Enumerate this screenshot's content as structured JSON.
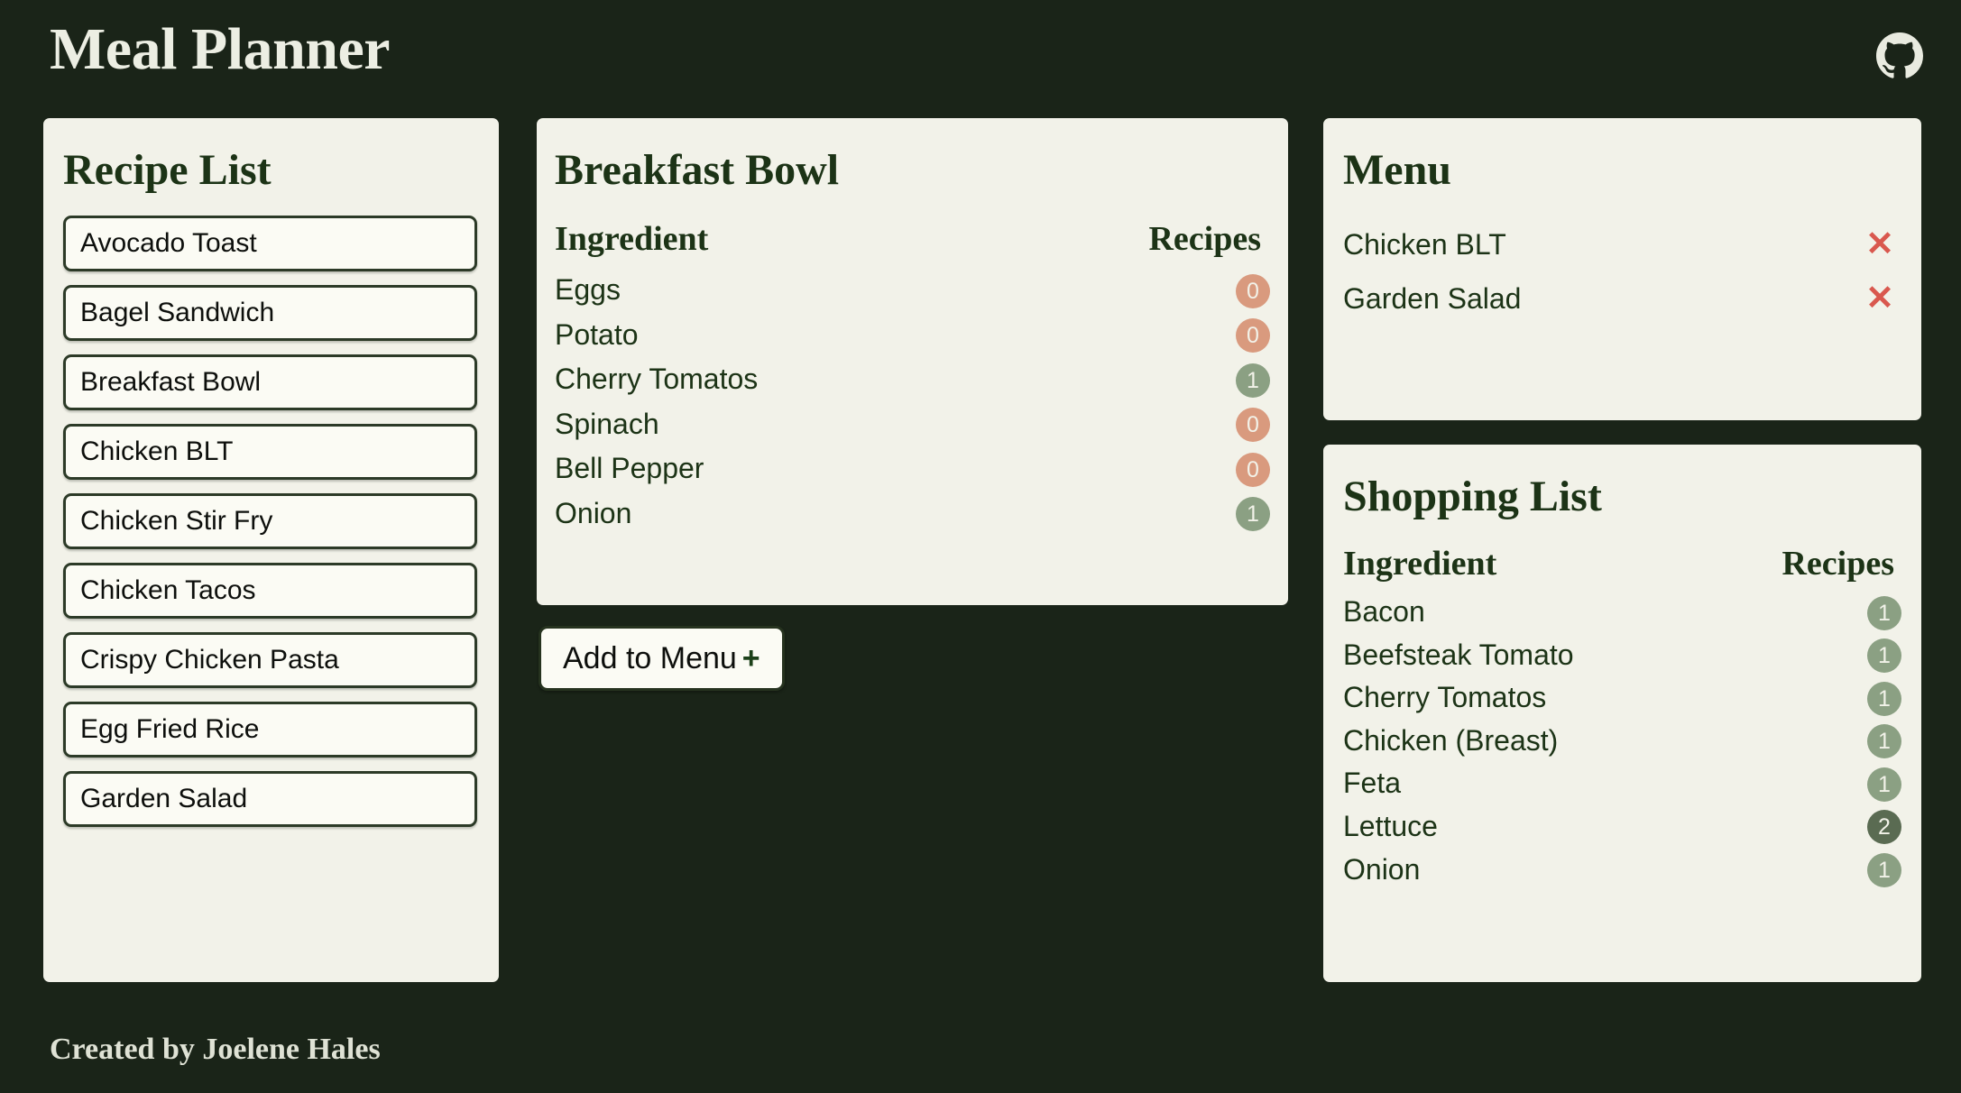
{
  "app": {
    "title": "Meal Planner",
    "background_color": "#1a2418",
    "panel_color": "#f2f2e9",
    "accent_green": "#1c3316"
  },
  "header": {
    "github_icon": "github-icon"
  },
  "recipe_list": {
    "title": "Recipe List",
    "items": [
      {
        "label": "Avocado Toast"
      },
      {
        "label": "Bagel Sandwich"
      },
      {
        "label": "Breakfast Bowl"
      },
      {
        "label": "Chicken BLT"
      },
      {
        "label": "Chicken Stir Fry"
      },
      {
        "label": "Chicken Tacos"
      },
      {
        "label": "Crispy Chicken Pasta"
      },
      {
        "label": "Egg Fried Rice"
      },
      {
        "label": "Garden Salad"
      }
    ]
  },
  "recipe_detail": {
    "title": "Breakfast Bowl",
    "columns": {
      "ingredient": "Ingredient",
      "recipes": "Recipes"
    },
    "rows": [
      {
        "ingredient": "Eggs",
        "count": "0",
        "badge": "zero"
      },
      {
        "ingredient": "Potato",
        "count": "0",
        "badge": "zero"
      },
      {
        "ingredient": "Cherry Tomatos",
        "count": "1",
        "badge": "one"
      },
      {
        "ingredient": "Spinach",
        "count": "0",
        "badge": "zero"
      },
      {
        "ingredient": "Bell Pepper",
        "count": "0",
        "badge": "zero"
      },
      {
        "ingredient": "Onion",
        "count": "1",
        "badge": "one"
      }
    ],
    "add_button": {
      "label": "Add to Menu",
      "plus": "+"
    }
  },
  "menu": {
    "title": "Menu",
    "items": [
      {
        "label": "Chicken BLT",
        "remove_icon": "✕"
      },
      {
        "label": "Garden Salad",
        "remove_icon": "✕"
      }
    ]
  },
  "shopping_list": {
    "title": "Shopping List",
    "columns": {
      "ingredient": "Ingredient",
      "recipes": "Recipes"
    },
    "rows": [
      {
        "ingredient": "Bacon",
        "count": "1",
        "badge": "one"
      },
      {
        "ingredient": "Beefsteak Tomato",
        "count": "1",
        "badge": "one"
      },
      {
        "ingredient": "Cherry Tomatos",
        "count": "1",
        "badge": "one"
      },
      {
        "ingredient": "Chicken (Breast)",
        "count": "1",
        "badge": "one"
      },
      {
        "ingredient": "Feta",
        "count": "1",
        "badge": "one"
      },
      {
        "ingredient": "Lettuce",
        "count": "2",
        "badge": "many"
      },
      {
        "ingredient": "Onion",
        "count": "1",
        "badge": "one"
      }
    ]
  },
  "footer": {
    "credit": "Created by Joelene Hales"
  },
  "badge_colors": {
    "zero": "#d99a7e",
    "one": "#8ba083",
    "many": "#5a6b52"
  }
}
